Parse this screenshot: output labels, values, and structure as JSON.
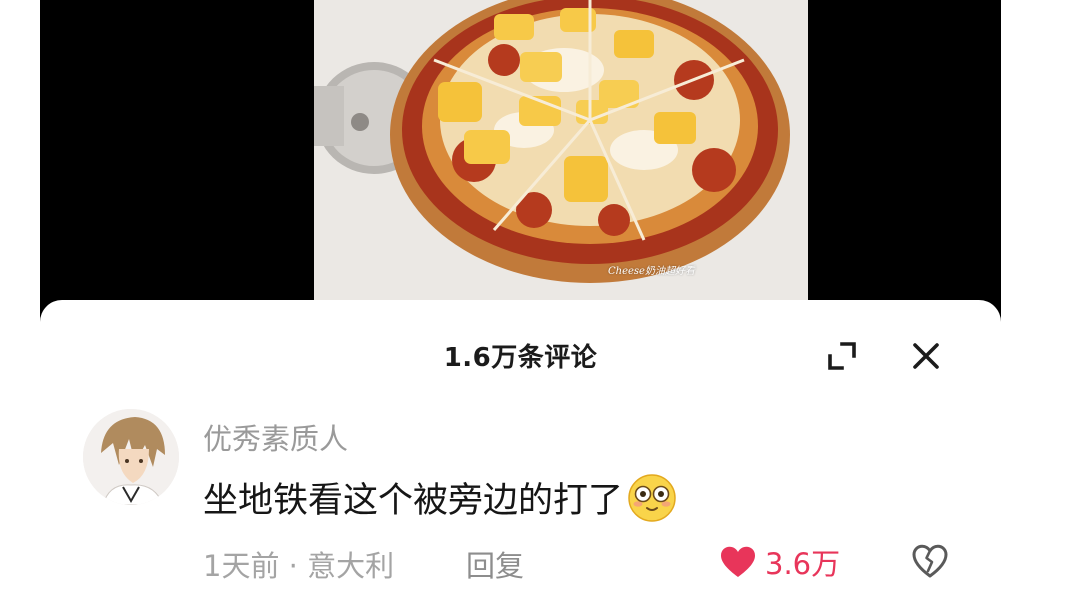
{
  "video": {
    "watermark": "Cheese奶油超好看"
  },
  "comments_panel": {
    "title": "1.6万条评论",
    "expand_icon": "expand-icon",
    "close_icon": "close-icon"
  },
  "comment": {
    "username": "优秀素质人",
    "text": "坐地铁看这个被旁边的打了",
    "emoji": "flushed-emoji",
    "time": "1天前",
    "separator": "·",
    "location": "意大利",
    "reply_label": "回复",
    "like_count": "3.6万",
    "like_icon": "heart-icon",
    "dislike_icon": "broken-heart-icon"
  },
  "colors": {
    "like": "#e8355a",
    "video_background": "#000000",
    "muted_text": "#9a9a9a"
  }
}
